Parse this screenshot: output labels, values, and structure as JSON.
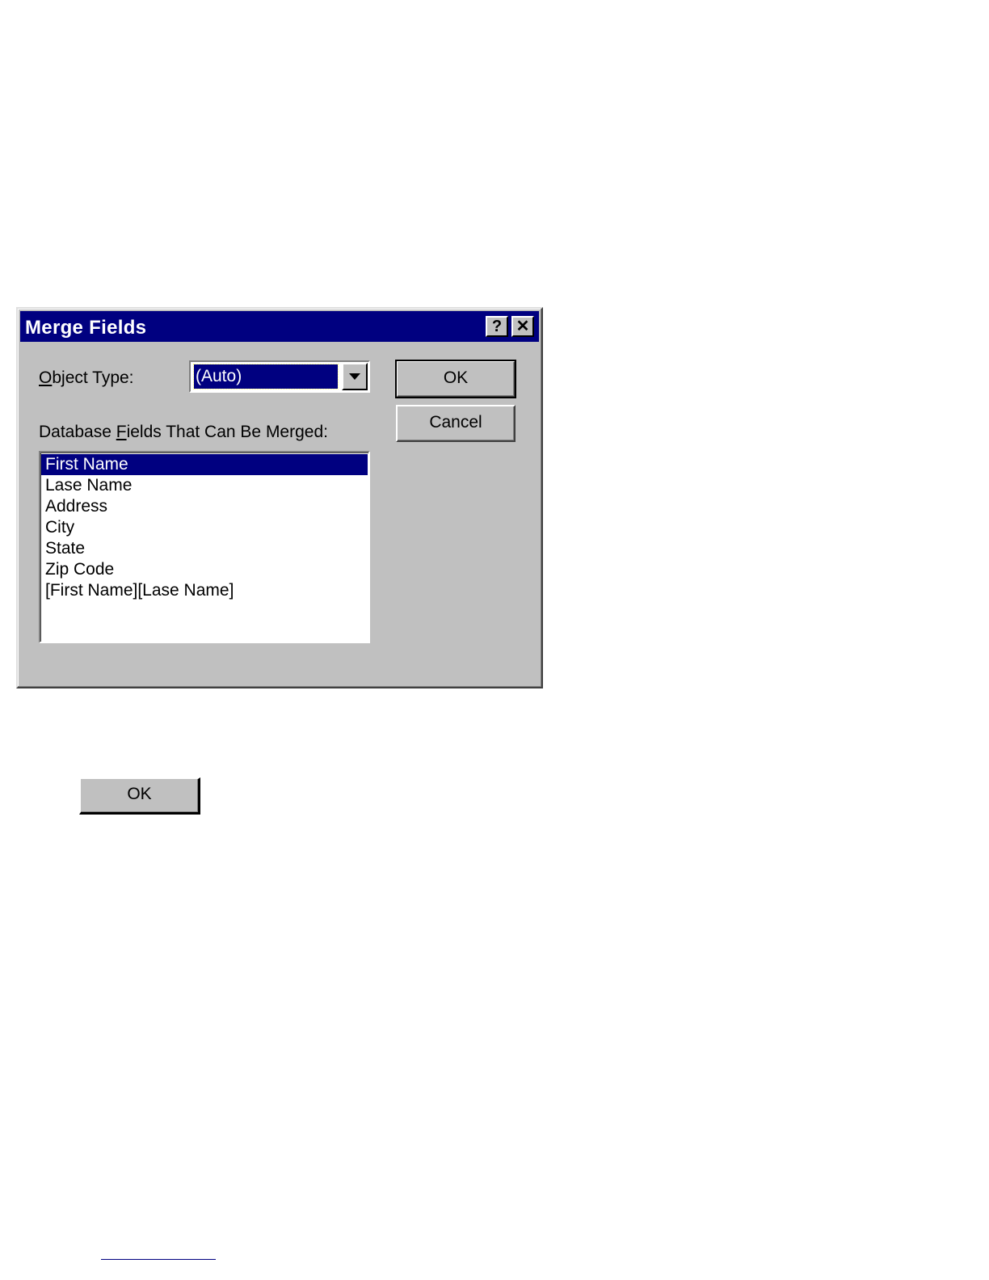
{
  "dialog": {
    "title": "Merge Fields",
    "help_button": "?",
    "close_button": "✕",
    "object_type_label_accel": "O",
    "object_type_label_rest": "bject Type:",
    "object_type_value": "(Auto)",
    "fields_label_pre": "Database ",
    "fields_label_accel": "F",
    "fields_label_post": "ields That Can Be Merged:",
    "ok_label": "OK",
    "cancel_label": "Cancel",
    "fields": [
      "First Name",
      "Lase Name",
      "Address",
      "City",
      "State",
      "Zip Code",
      "[First Name][Lase Name]"
    ],
    "selected_field": "First Name"
  },
  "standalone_button": {
    "label": "OK"
  },
  "colors": {
    "titlebar": "#000080",
    "face": "#c0c0c0",
    "selection": "#000080"
  }
}
